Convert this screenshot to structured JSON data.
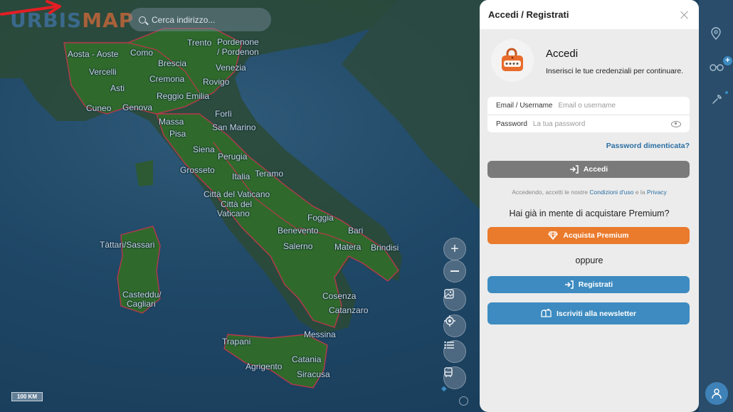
{
  "app": {
    "logo_prefix": "URBIS",
    "logo_suffix": "MAP"
  },
  "search": {
    "placeholder": "Cerca indirizzo..."
  },
  "map": {
    "scale_label": "100 KM",
    "cities": [
      "Aosta - Aoste",
      "Como",
      "Trento",
      "Pordenone",
      "/ Pordenon",
      "Brescia",
      "Vercelli",
      "Cremona",
      "Venezia",
      "Rovigo",
      "Asti",
      "Reggio Emilia",
      "Cuneo",
      "Genova",
      "Forlì",
      "Massa",
      "San Marino",
      "Pisa",
      "Siena",
      "Perugia",
      "Grosseto",
      "Italia",
      "Teramo",
      "Città del",
      "Città del Vaticano",
      "Vaticano",
      "Foggia",
      "Bari",
      "Tàttari/Sassari",
      "Benevento",
      "Salerno",
      "Matera",
      "Brindisi",
      "Casteddu/",
      "Cagliari",
      "Cosenza",
      "Catanzaro",
      "Messina",
      "Trapani",
      "Catania",
      "Agrigento",
      "Siracusa"
    ]
  },
  "panel": {
    "title": "Accedi / Registrati",
    "heading": "Accedi",
    "subheading": "Inserisci le tue credenziali per continuare.",
    "email_label": "Email / Username",
    "email_placeholder": "Email o username",
    "password_label": "Password",
    "password_placeholder": "La tua password",
    "forgot_link": "Password dimenticata?",
    "login_button": "Accedi",
    "terms_prefix": "Accedendo, accetti le nostre",
    "terms_link": "Condizioni d'uso",
    "terms_and": "e la",
    "privacy_link": "Privacy",
    "premium_question": "Hai già in mente di acquistare Premium?",
    "premium_button": "Acquista Premium",
    "or_text": "oppure",
    "register_button": "Registrati",
    "newsletter_button": "Iscriviti alla newsletter"
  },
  "colors": {
    "premium": "#ea7a2c",
    "primary": "#3d8bc0",
    "login_disabled": "#7a7a7a",
    "link": "#2b6fa3"
  }
}
